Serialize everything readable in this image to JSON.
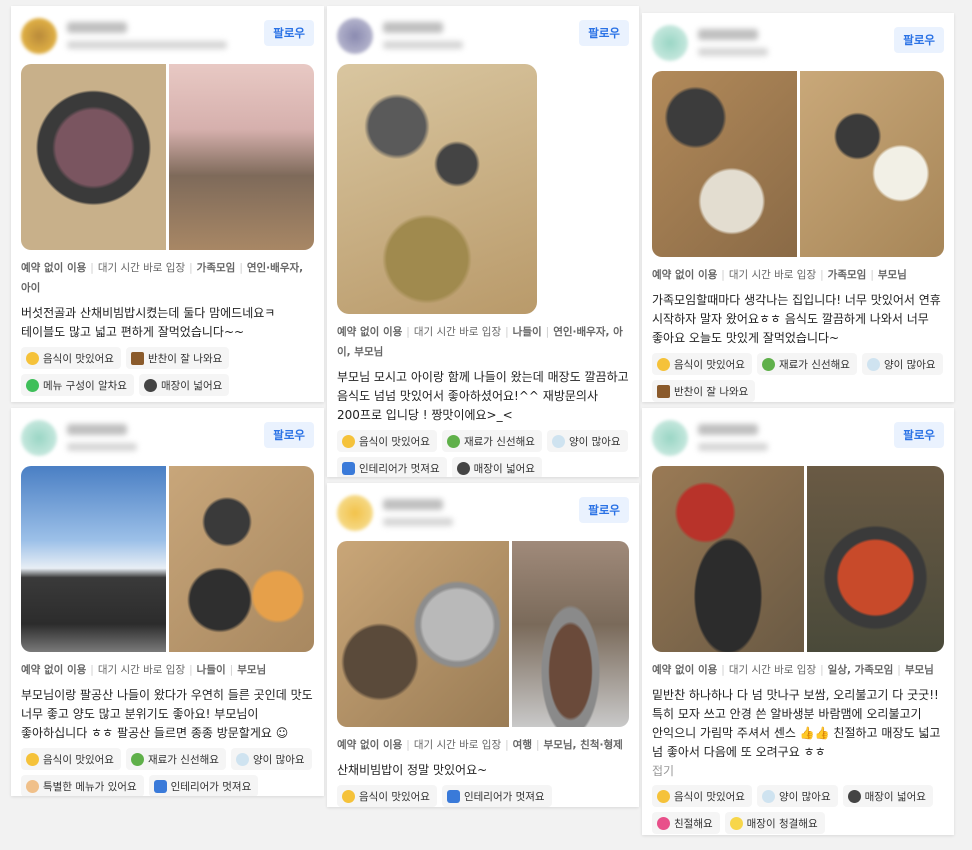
{
  "follow_label": "팔로우",
  "cards": [
    {
      "tags": [
        "예약 없이 이용",
        "대기 시간 바로 입장",
        "가족모임",
        "연인·배우자, 아이"
      ],
      "text": "버섯전골과 산채비빔밥시켰는데 둘다 맘에드네요ㅋ 테이블도 많고 넓고 편하게 잘먹었습니다~~",
      "chips": [
        {
          "icon": "yum-face-icon",
          "label": "음식이 맛있어요"
        },
        {
          "icon": "side-dish-icon",
          "label": "반찬이 잘 나와요"
        },
        {
          "icon": "heart-icon",
          "label": "메뉴 구성이 알차요"
        },
        {
          "icon": "eyes-icon",
          "label": "매장이 넓어요"
        }
      ]
    },
    {
      "tags": [
        "예약 없이 이용",
        "대기 시간 바로 입장",
        "나들이",
        "연인·배우자, 아이, 부모님"
      ],
      "text": "부모님 모시고 아이랑 함께 나들이 왔는데 매장도 깔끔하고 음식도 넘넘 맛있어서 좋아하셨어요!^^ 재방문의사 200프로 입니당 ! 짱맛이에요>_<",
      "chips": [
        {
          "icon": "yum-face-icon",
          "label": "음식이 맛있어요"
        },
        {
          "icon": "leaf-icon",
          "label": "재료가 신선해요"
        },
        {
          "icon": "bowl-icon",
          "label": "양이 많아요"
        },
        {
          "icon": "sofa-icon",
          "label": "인테리어가 멋져요"
        },
        {
          "icon": "eyes-icon",
          "label": "매장이 넓어요"
        }
      ]
    },
    {
      "tags": [
        "예약 없이 이용",
        "대기 시간 바로 입장",
        "가족모임",
        "부모님"
      ],
      "text": "가족모임할때마다 생각나는 집입니다! 너무 맛있어서 연휴 시작하자 말자 왔어요ㅎㅎ 음식도 깔끔하게 나와서 너무 좋아요 오늘도 맛있게 잘먹었습니다~",
      "chips": [
        {
          "icon": "yum-face-icon",
          "label": "음식이 맛있어요"
        },
        {
          "icon": "leaf-icon",
          "label": "재료가 신선해요"
        },
        {
          "icon": "bowl-icon",
          "label": "양이 많아요"
        },
        {
          "icon": "side-dish-icon",
          "label": "반찬이 잘 나와요"
        }
      ]
    },
    {
      "tags": [
        "예약 없이 이용",
        "대기 시간 바로 입장",
        "나들이",
        "부모님"
      ],
      "text": "부모님이랑 팔공산 나들이 왔다가 우연히 들른 곳인데 맛도 너무 좋고 양도 많고 분위기도 좋아요! 부모님이 좋아하십니다 ㅎㅎ 팔공산 들르면 종종 방문할게요 ☺",
      "chips": [
        {
          "icon": "yum-face-icon",
          "label": "음식이 맛있어요"
        },
        {
          "icon": "leaf-icon",
          "label": "재료가 신선해요"
        },
        {
          "icon": "bowl-icon",
          "label": "양이 많아요"
        },
        {
          "icon": "chef-icon",
          "label": "특별한 메뉴가 있어요"
        },
        {
          "icon": "sofa-icon",
          "label": "인테리어가 멋져요"
        }
      ]
    },
    {
      "tags": [
        "예약 없이 이용",
        "대기 시간 바로 입장",
        "여행",
        "부모님, 친척·형제"
      ],
      "text": "산채비빔밥이 정말 맛있어요~",
      "chips": [
        {
          "icon": "yum-face-icon",
          "label": "음식이 맛있어요"
        },
        {
          "icon": "sofa-icon",
          "label": "인테리어가 멋져요"
        }
      ]
    },
    {
      "tags": [
        "예약 없이 이용",
        "대기 시간 바로 입장",
        "일상, 가족모임",
        "부모님"
      ],
      "text": "밑반찬 하나하나 다 넘 맛나구 보쌈, 오리불고기 다 굿굿!! 특히 모자 쓰고 안경 쓴 알바생분 바람맴에 오리불고기 안익으니 가림막 주셔서 센스 👍👍 친절하고 매장도 넓고 넘 좋아서 다음에 또 오려구요 ㅎㅎ",
      "fold": "접기",
      "chips": [
        {
          "icon": "yum-face-icon",
          "label": "음식이 맛있어요"
        },
        {
          "icon": "bowl-icon",
          "label": "양이 많아요"
        },
        {
          "icon": "eyes-icon",
          "label": "매장이 넓어요"
        },
        {
          "icon": "heart-hands-icon",
          "label": "친절해요"
        },
        {
          "icon": "sparkle-icon",
          "label": "매장이 청결해요"
        }
      ]
    }
  ],
  "colors": {
    "follow_text": "#2a72e5",
    "follow_bg": "#eaf2fe",
    "chip_bg": "#f5f5f5"
  }
}
